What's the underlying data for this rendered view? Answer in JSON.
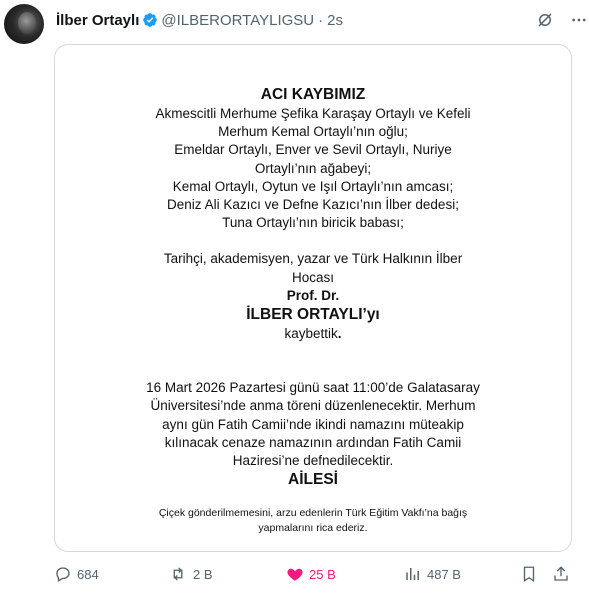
{
  "tweet": {
    "author_name": "İlber Ortaylı",
    "handle": "@ILBERORTAYLIGSU",
    "separator": "·",
    "time": "2s"
  },
  "notice": {
    "title": "ACI KAYBIMIZ",
    "family_lines": [
      "Akmescitli Merhume Şefika Karaşay Ortaylı ve Kefeli",
      "Merhum Kemal Ortaylı’nın oğlu;",
      "Emeldar Ortaylı, Enver ve Sevil Ortaylı, Nuriye",
      "Ortaylı’nın ağabeyi;",
      "Kemal Ortaylı, Oytun ve Işıl Ortaylı’nın amcası;",
      "Deniz Ali Kazıcı ve Defne Kazıcı’nın İlber dedesi;",
      "Tuna Ortaylı’nın biricik babası;"
    ],
    "role_lines": [
      "Tarihçi, akademisyen, yazar ve Türk Halkının İlber",
      "Hocası"
    ],
    "title_line": "Prof. Dr.",
    "full_name": "İLBER ORTAYLI’yı",
    "lost_text": "kaybettik",
    "lost_punct": ".",
    "ceremony_lines": [
      "16 Mart 2026 Pazartesi günü saat 11:00’de Galatasaray",
      "Üniversitesi’nde anma töreni düzenlenecektir. Merhum",
      "aynı gün Fatih Camii’nde ikindi namazını müteakip",
      "kılınacak cenaze namazının ardından Fatih Camii",
      "Haziresi’ne defnedilecektir."
    ],
    "signature": "AİLESİ",
    "footnote_lines": [
      "Çiçek gönderilmemesini, arzu edenlerin Türk Eğitim Vakfı’na bağış",
      "yapmalarını rica ederiz."
    ]
  },
  "actions": {
    "replies": "684",
    "reposts": "2 B",
    "likes": "25 B",
    "views": "487 B"
  },
  "colors": {
    "verified": "#1d9bf0",
    "like": "#f91880",
    "muted": "#536471"
  }
}
